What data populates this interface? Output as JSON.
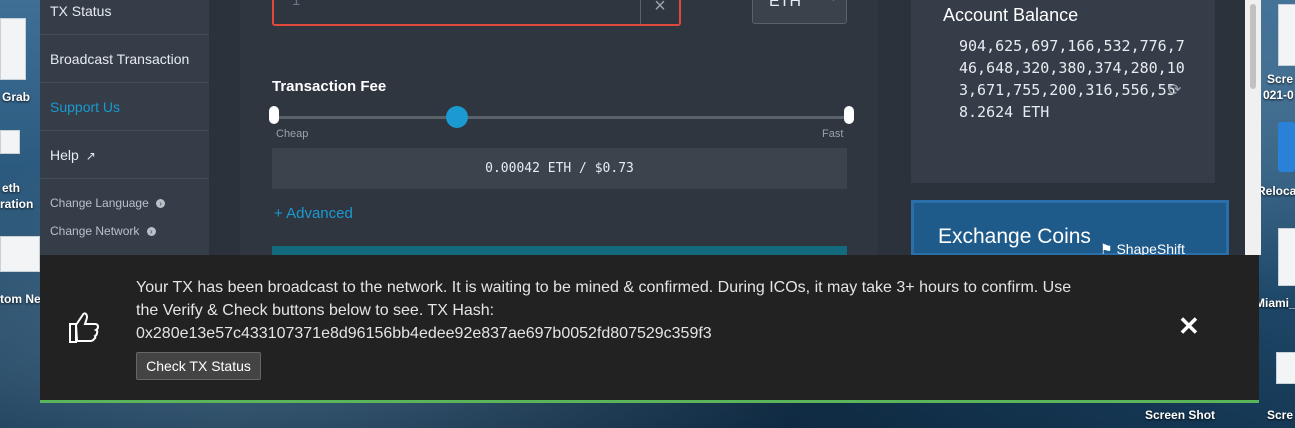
{
  "desktop": {
    "left_labels": [
      "Grab",
      "eth",
      "ration",
      "tom Ne"
    ],
    "right_labels": [
      "Scre",
      "021-0",
      "Reloca",
      "Miami_",
      "Screen Shot",
      "Scre"
    ]
  },
  "sidebar": {
    "items": [
      {
        "label": "TX Status"
      },
      {
        "label": "Broadcast Transaction"
      },
      {
        "label": "Support Us"
      },
      {
        "label": "Help"
      }
    ],
    "small_items": [
      {
        "label": "Change Language"
      },
      {
        "label": "Change Network"
      }
    ]
  },
  "send": {
    "amount_placeholder": "1",
    "unit": "ETH",
    "fee_title": "Transaction Fee",
    "slider_min_label": "Cheap",
    "slider_max_label": "Fast",
    "fee_display": "0.00042 ETH / $0.73",
    "advanced_label": "+ Advanced"
  },
  "balance": {
    "title": "Account Balance",
    "value": "904,625,697,166,532,776,746,648,320,380,374,280,103,671,755,200,316,556,558.2624 ETH"
  },
  "exchange": {
    "title": "Exchange Coins",
    "brand": "ShapeShift"
  },
  "notification": {
    "message": "Your TX has been broadcast to the network. It is waiting to be mined & confirmed. During ICOs, it may take 3+ hours to confirm. Use the Verify & Check buttons below to see. TX Hash:",
    "tx_hash": "0x280e13e57c433107371e8d96156bb4edee92e837ae697b0052fd807529c359f3",
    "check_button": "Check TX Status"
  },
  "colors": {
    "accent": "#1a9ad0",
    "error_border": "#e0483b",
    "success_border": "#5ab55a"
  }
}
